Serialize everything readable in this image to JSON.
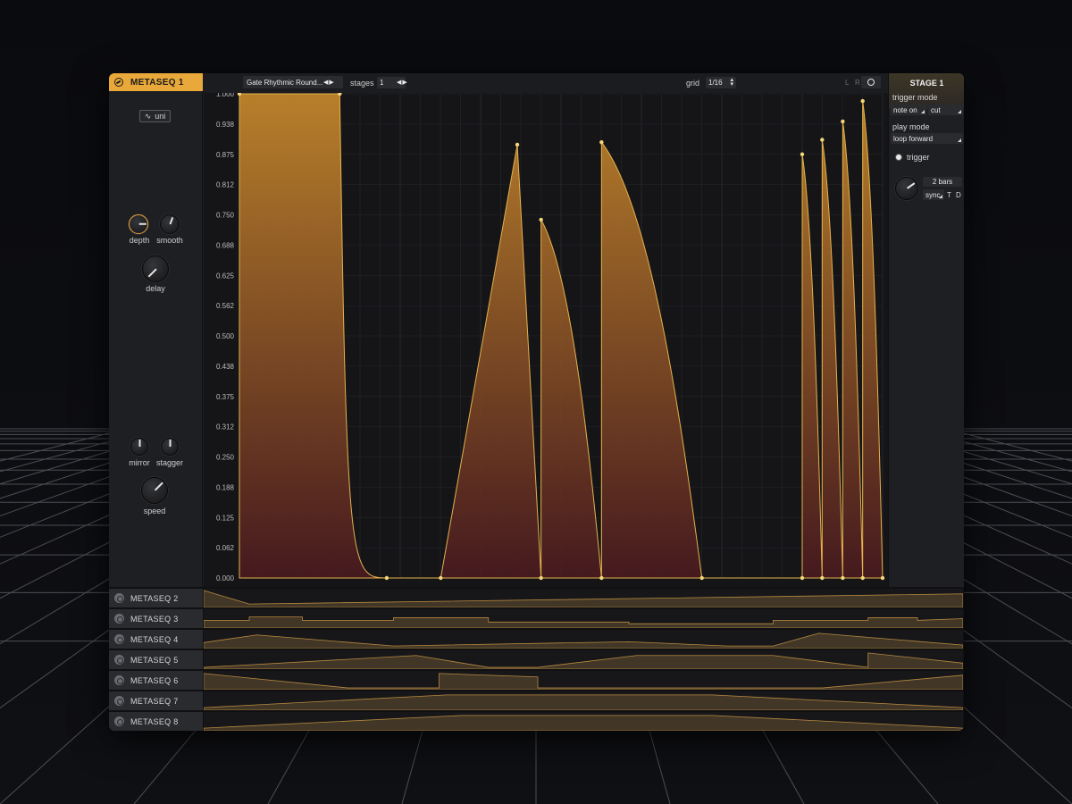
{
  "window": {
    "active_lane": "METASEQ 1"
  },
  "left_panel": {
    "polarity_label": "uni",
    "knobs": {
      "depth": "depth",
      "smooth": "smooth",
      "delay": "delay",
      "mirror": "mirror",
      "stagger": "stagger",
      "speed": "speed"
    }
  },
  "toolbar": {
    "preset_name": "Gate Rhythmic Round...",
    "stages_label": "stages",
    "stages_value": "1",
    "grid_label": "grid",
    "grid_value": "1/16",
    "left_label": "L",
    "right_label": "R"
  },
  "right_panel": {
    "stage_title": "STAGE 1",
    "trigger_mode_label": "trigger mode",
    "trigger_mode_value": "note on",
    "trigger_cut_value": "cut",
    "play_mode_label": "play mode",
    "play_mode_value": "loop forward",
    "trigger_label": "trigger",
    "length_value": "2 bars",
    "sync_value": "sync",
    "t_label": "T",
    "d_label": "D"
  },
  "y_axis_labels": [
    "1.000",
    "0.938",
    "0.875",
    "0.812",
    "0.750",
    "0.688",
    "0.625",
    "0.562",
    "0.500",
    "0.438",
    "0.375",
    "0.312",
    "0.250",
    "0.188",
    "0.125",
    "0.062",
    "0.000"
  ],
  "colors": {
    "accent": "#e9a83a",
    "curve_top": "#c98a2c",
    "curve_bottom": "#4a1a1f",
    "grid": "#26272b"
  },
  "envelope": {
    "x_range": [
      0,
      1
    ],
    "y_range": [
      0,
      1
    ],
    "points": [
      {
        "x": 0.0,
        "y": 1.0,
        "shape": "hold"
      },
      {
        "x": 0.156,
        "y": 1.0,
        "shape": "exp-down"
      },
      {
        "x": 0.229,
        "y": 0.0,
        "shape": "hold"
      },
      {
        "x": 0.313,
        "y": 0.0,
        "shape": "lin-up"
      },
      {
        "x": 0.432,
        "y": 0.895,
        "shape": "drop"
      },
      {
        "x": 0.469,
        "y": 0.0,
        "shape": "jump"
      },
      {
        "x": 0.469,
        "y": 0.74,
        "shape": "curve-down"
      },
      {
        "x": 0.563,
        "y": 0.0,
        "shape": "jump"
      },
      {
        "x": 0.563,
        "y": 0.9,
        "shape": "curve-down"
      },
      {
        "x": 0.719,
        "y": 0.0,
        "shape": "hold"
      },
      {
        "x": 0.875,
        "y": 0.0,
        "shape": "jump"
      },
      {
        "x": 0.875,
        "y": 0.875,
        "shape": "curve-down"
      },
      {
        "x": 0.906,
        "y": 0.0,
        "shape": "jump"
      },
      {
        "x": 0.906,
        "y": 0.905,
        "shape": "curve-down"
      },
      {
        "x": 0.938,
        "y": 0.0,
        "shape": "jump"
      },
      {
        "x": 0.938,
        "y": 0.943,
        "shape": "curve-down"
      },
      {
        "x": 0.969,
        "y": 0.0,
        "shape": "jump"
      },
      {
        "x": 0.969,
        "y": 0.985,
        "shape": "curve-down"
      },
      {
        "x": 1.0,
        "y": 0.0,
        "shape": "end"
      }
    ]
  },
  "lanes": [
    {
      "label": "METASEQ 2",
      "points": [
        [
          0,
          0.95
        ],
        [
          0.06,
          0.15
        ],
        [
          1,
          0.75
        ]
      ]
    },
    {
      "label": "METASEQ 3",
      "points": [
        [
          0,
          0.4
        ],
        [
          0.06,
          0.4
        ],
        [
          0.06,
          0.6
        ],
        [
          0.13,
          0.6
        ],
        [
          0.13,
          0.4
        ],
        [
          0.25,
          0.4
        ],
        [
          0.25,
          0.55
        ],
        [
          0.375,
          0.55
        ],
        [
          0.375,
          0.3
        ],
        [
          0.56,
          0.3
        ],
        [
          0.56,
          0.2
        ],
        [
          0.75,
          0.2
        ],
        [
          0.75,
          0.4
        ],
        [
          0.875,
          0.4
        ],
        [
          0.875,
          0.55
        ],
        [
          0.94,
          0.55
        ],
        [
          0.94,
          0.4
        ],
        [
          1,
          0.5
        ]
      ]
    },
    {
      "label": "METASEQ 4",
      "points": [
        [
          0,
          0.3
        ],
        [
          0.07,
          0.75
        ],
        [
          0.25,
          0.1
        ],
        [
          0.56,
          0.35
        ],
        [
          0.69,
          0.1
        ],
        [
          0.75,
          0.1
        ],
        [
          0.81,
          0.85
        ],
        [
          1,
          0.15
        ]
      ]
    },
    {
      "label": "METASEQ 5",
      "points": [
        [
          0,
          0.05
        ],
        [
          0.28,
          0.75
        ],
        [
          0.375,
          0.05
        ],
        [
          0.44,
          0.05
        ],
        [
          0.57,
          0.75
        ],
        [
          0.75,
          0.75
        ],
        [
          0.875,
          0.05
        ],
        [
          0.875,
          0.9
        ],
        [
          1,
          0.3
        ]
      ]
    },
    {
      "label": "METASEQ 6",
      "points": [
        [
          0,
          0.9
        ],
        [
          0.19,
          0.05
        ],
        [
          0.31,
          0.05
        ],
        [
          0.31,
          0.9
        ],
        [
          0.44,
          0.7
        ],
        [
          0.44,
          0.05
        ],
        [
          0.815,
          0.05
        ],
        [
          1,
          0.8
        ]
      ]
    },
    {
      "label": "METASEQ 7",
      "points": [
        [
          0,
          0.1
        ],
        [
          0.32,
          0.85
        ],
        [
          0.67,
          0.85
        ],
        [
          1,
          0.1
        ]
      ]
    },
    {
      "label": "METASEQ 8",
      "points": [
        [
          0,
          0.1
        ],
        [
          0.34,
          0.85
        ],
        [
          0.67,
          0.85
        ],
        [
          1,
          0.1
        ]
      ]
    }
  ]
}
